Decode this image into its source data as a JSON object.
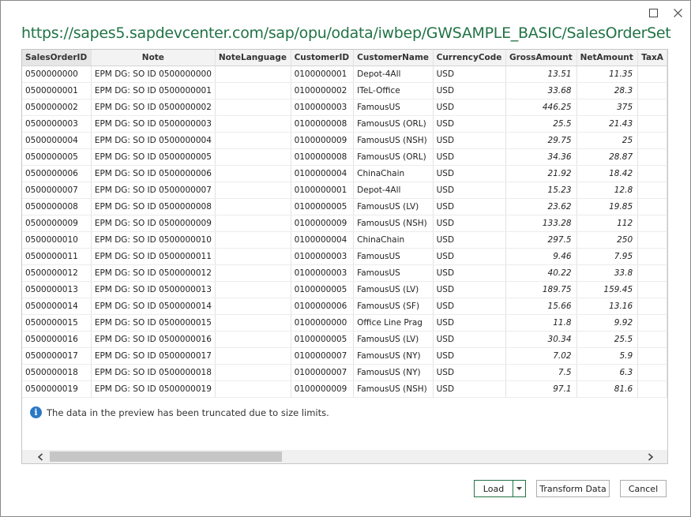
{
  "window": {
    "title": "https://sapes5.sapdevcenter.com/sap/opu/odata/iwbep/GWSAMPLE_BASIC/SalesOrderSet"
  },
  "table": {
    "columns": [
      "SalesOrderID",
      "Note",
      "NoteLanguage",
      "CustomerID",
      "CustomerName",
      "CurrencyCode",
      "GrossAmount",
      "NetAmount",
      "TaxA"
    ],
    "rows": [
      [
        "0500000000",
        "EPM DG: SO ID 0500000000",
        "",
        "0100000001",
        "Depot-4All",
        "USD",
        "13.51",
        "11.35"
      ],
      [
        "0500000001",
        "EPM DG: SO ID 0500000001",
        "",
        "0100000002",
        "ITeL-Office",
        "USD",
        "33.68",
        "28.3"
      ],
      [
        "0500000002",
        "EPM DG: SO ID 0500000002",
        "",
        "0100000003",
        "FamousUS",
        "USD",
        "446.25",
        "375"
      ],
      [
        "0500000003",
        "EPM DG: SO ID 0500000003",
        "",
        "0100000008",
        "FamousUS (ORL)",
        "USD",
        "25.5",
        "21.43"
      ],
      [
        "0500000004",
        "EPM DG: SO ID 0500000004",
        "",
        "0100000009",
        "FamousUS (NSH)",
        "USD",
        "29.75",
        "25"
      ],
      [
        "0500000005",
        "EPM DG: SO ID 0500000005",
        "",
        "0100000008",
        "FamousUS (ORL)",
        "USD",
        "34.36",
        "28.87"
      ],
      [
        "0500000006",
        "EPM DG: SO ID 0500000006",
        "",
        "0100000004",
        "ChinaChain",
        "USD",
        "21.92",
        "18.42"
      ],
      [
        "0500000007",
        "EPM DG: SO ID 0500000007",
        "",
        "0100000001",
        "Depot-4All",
        "USD",
        "15.23",
        "12.8"
      ],
      [
        "0500000008",
        "EPM DG: SO ID 0500000008",
        "",
        "0100000005",
        "FamousUS (LV)",
        "USD",
        "23.62",
        "19.85"
      ],
      [
        "0500000009",
        "EPM DG: SO ID 0500000009",
        "",
        "0100000009",
        "FamousUS (NSH)",
        "USD",
        "133.28",
        "112"
      ],
      [
        "0500000010",
        "EPM DG: SO ID 0500000010",
        "",
        "0100000004",
        "ChinaChain",
        "USD",
        "297.5",
        "250"
      ],
      [
        "0500000011",
        "EPM DG: SO ID 0500000011",
        "",
        "0100000003",
        "FamousUS",
        "USD",
        "9.46",
        "7.95"
      ],
      [
        "0500000012",
        "EPM DG: SO ID 0500000012",
        "",
        "0100000003",
        "FamousUS",
        "USD",
        "40.22",
        "33.8"
      ],
      [
        "0500000013",
        "EPM DG: SO ID 0500000013",
        "",
        "0100000005",
        "FamousUS (LV)",
        "USD",
        "189.75",
        "159.45"
      ],
      [
        "0500000014",
        "EPM DG: SO ID 0500000014",
        "",
        "0100000006",
        "FamousUS (SF)",
        "USD",
        "15.66",
        "13.16"
      ],
      [
        "0500000015",
        "EPM DG: SO ID 0500000015",
        "",
        "0100000000",
        "Office Line Prag",
        "USD",
        "11.8",
        "9.92"
      ],
      [
        "0500000016",
        "EPM DG: SO ID 0500000016",
        "",
        "0100000005",
        "FamousUS (LV)",
        "USD",
        "30.34",
        "25.5"
      ],
      [
        "0500000017",
        "EPM DG: SO ID 0500000017",
        "",
        "0100000007",
        "FamousUS (NY)",
        "USD",
        "7.02",
        "5.9"
      ],
      [
        "0500000018",
        "EPM DG: SO ID 0500000018",
        "",
        "0100000007",
        "FamousUS (NY)",
        "USD",
        "7.5",
        "6.3"
      ],
      [
        "0500000019",
        "EPM DG: SO ID 0500000019",
        "",
        "0100000009",
        "FamousUS (NSH)",
        "USD",
        "97.1",
        "81.6"
      ]
    ]
  },
  "notice": {
    "text": "The data in the preview has been truncated due to size limits.",
    "icon": "info-icon"
  },
  "buttons": {
    "load": "Load",
    "transform": "Transform Data",
    "cancel": "Cancel"
  },
  "colors": {
    "accent": "#217346",
    "info": "#2b78c5"
  }
}
